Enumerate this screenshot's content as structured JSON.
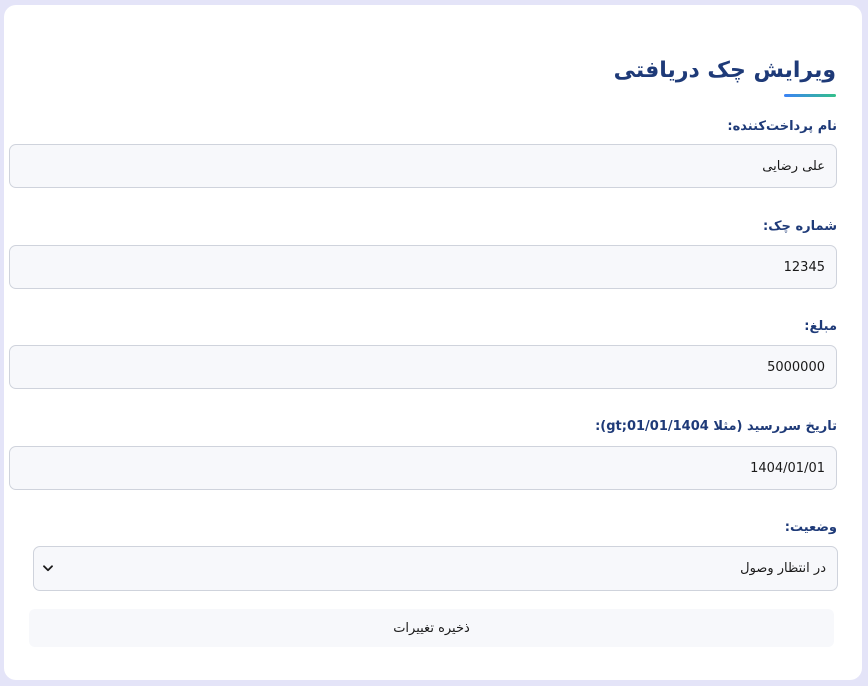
{
  "form": {
    "title": "ویرایش چک دریافتی",
    "fields": {
      "payer_name": {
        "label": "نام پرداخت‌کننده:",
        "value": "علی رضایی"
      },
      "check_number": {
        "label": "شماره چک:",
        "value": "12345"
      },
      "amount": {
        "label": "مبلغ:",
        "value": "5000000"
      },
      "due_date": {
        "label": "تاریخ سررسید (مثلا gt;01/01/1404):",
        "value": "1404/01/01"
      },
      "status": {
        "label": "وضعیت:",
        "selected": "در انتظار وصول",
        "icon": "chevron-down-icon"
      }
    },
    "save_label": "ذخیره تغییرات"
  },
  "colors": {
    "page_background": "#e4e4f8",
    "title": "#1e3a78",
    "accent_start": "#3b82f6",
    "accent_end": "#33c08a",
    "field_background": "#f7f8fb",
    "field_border": "#cfd3dc"
  }
}
